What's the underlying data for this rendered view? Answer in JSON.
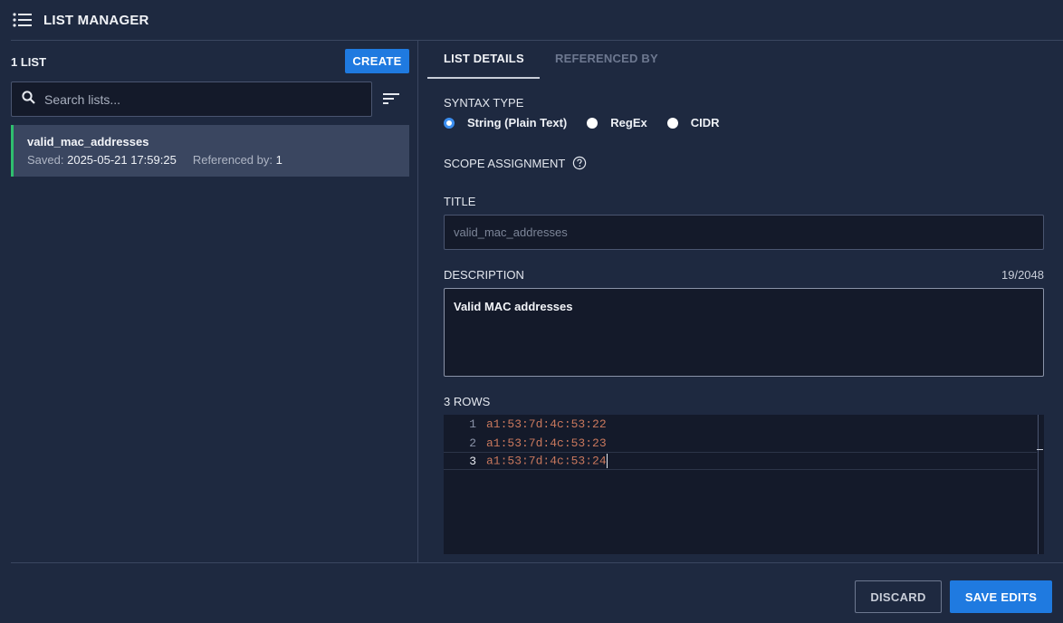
{
  "header": {
    "title": "LIST MANAGER",
    "icon": "list-icon"
  },
  "left": {
    "list_count": "1 LIST",
    "create_label": "CREATE",
    "search": {
      "placeholder": "Search lists...",
      "value": ""
    },
    "items": [
      {
        "name": "valid_mac_addresses",
        "saved_label": "Saved:",
        "saved_value": "2025-05-21 17:59:25",
        "referenced_label": "Referenced by:",
        "referenced_value": "1"
      }
    ]
  },
  "right": {
    "tabs": [
      {
        "label": "LIST DETAILS",
        "active": true
      },
      {
        "label": "REFERENCED BY",
        "active": false
      }
    ],
    "syntax_type_label": "SYNTAX TYPE",
    "syntax_options": [
      {
        "label": "String (Plain Text)",
        "selected": true
      },
      {
        "label": "RegEx",
        "selected": false
      },
      {
        "label": "CIDR",
        "selected": false
      }
    ],
    "scope_label": "SCOPE ASSIGNMENT",
    "title_label": "TITLE",
    "title_value": "valid_mac_addresses",
    "description_label": "DESCRIPTION",
    "description_counter": "19/2048",
    "description_value": "Valid MAC addresses",
    "rows_label": "3 ROWS",
    "rows": [
      {
        "num": "1",
        "value": "a1:53:7d:4c:53:22"
      },
      {
        "num": "2",
        "value": "a1:53:7d:4c:53:23"
      },
      {
        "num": "3",
        "value": "a1:53:7d:4c:53:24"
      }
    ]
  },
  "footer": {
    "discard_label": "DISCARD",
    "save_label": "SAVE EDITS"
  },
  "colors": {
    "accent": "#1f7ae0",
    "active_item_bar": "#2fbf6e",
    "background": "#1e2940",
    "code_text": "#c9785d"
  }
}
